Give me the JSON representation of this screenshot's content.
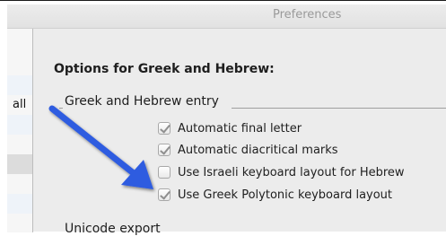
{
  "window": {
    "title": "Preferences"
  },
  "sidebar": {
    "items": [
      {
        "label": ""
      },
      {
        "label": "all"
      },
      {
        "label": ""
      },
      {
        "label": ""
      },
      {
        "label": ""
      },
      {
        "label": ""
      }
    ]
  },
  "section": {
    "title": "Options for Greek and Hebrew:"
  },
  "greek_hebrew_entry": {
    "title": "Greek and Hebrew entry",
    "options": [
      {
        "label": "Automatic final letter",
        "checked": true
      },
      {
        "label": "Automatic diacritical marks",
        "checked": true
      },
      {
        "label": "Use Israeli keyboard layout for Hebrew",
        "checked": false
      },
      {
        "label": "Use Greek Polytonic keyboard layout",
        "checked": true
      }
    ]
  },
  "unicode_export": {
    "title": "Unicode export"
  },
  "annotation": {
    "arrow_color": "#2f5be0"
  }
}
